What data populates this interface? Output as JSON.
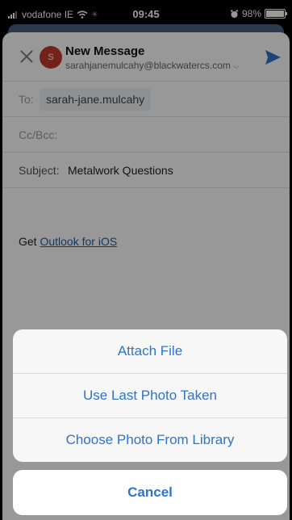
{
  "status_bar": {
    "carrier": "vodafone IE",
    "time": "09:45",
    "battery": "98%",
    "battery_level": 0.98,
    "icons": [
      "signal-icon",
      "wifi-icon",
      "alarm-icon",
      "battery-icon"
    ]
  },
  "compose": {
    "title": "New Message",
    "avatar_initial": "S",
    "from": "sarahjanemulcahy@blackwatercs.com",
    "to_label": "To:",
    "to_value": "sarah-jane.mulcahy",
    "ccbcc_label": "Cc/Bcc:",
    "subject_label": "Subject:",
    "subject_value": "Metalwork Questions",
    "body_prefix": "Get",
    "body_link": "Outlook for iOS"
  },
  "action_sheet": {
    "items": [
      "Attach File",
      "Use Last Photo Taken",
      "Choose Photo From Library"
    ],
    "cancel": "Cancel"
  },
  "colors": {
    "accent": "#2e74c8",
    "avatar": "#c0392b",
    "link": "#1f5fa6"
  }
}
